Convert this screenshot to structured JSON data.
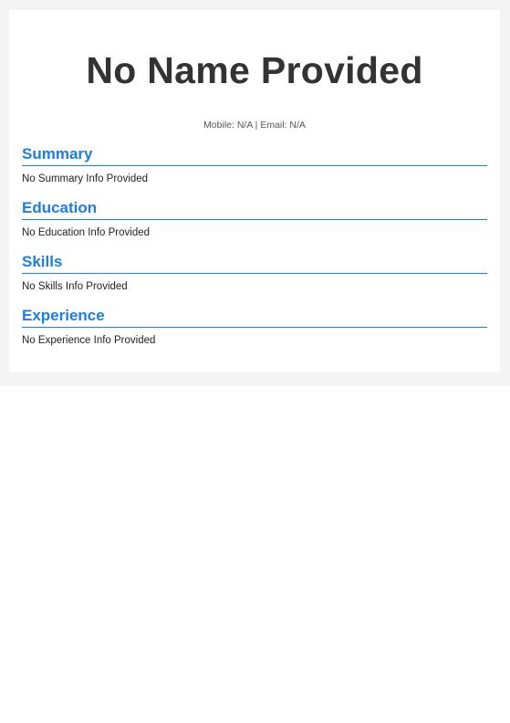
{
  "resume": {
    "name": "No Name Provided",
    "contact": "Mobile: N/A | Email: N/A"
  },
  "sections": {
    "summary": {
      "heading": "Summary",
      "text": "No Summary Info Provided"
    },
    "education": {
      "heading": "Education",
      "text": "No Education Info Provided"
    },
    "skills": {
      "heading": "Skills",
      "text": "No Skills Info Provided"
    },
    "experience": {
      "heading": "Experience",
      "text": "No Experience Info Provided"
    }
  },
  "colors": {
    "accent": "#1a7ee5",
    "title": "#333333",
    "page_background": "#f4f4f4",
    "card_background": "#ffffff"
  }
}
